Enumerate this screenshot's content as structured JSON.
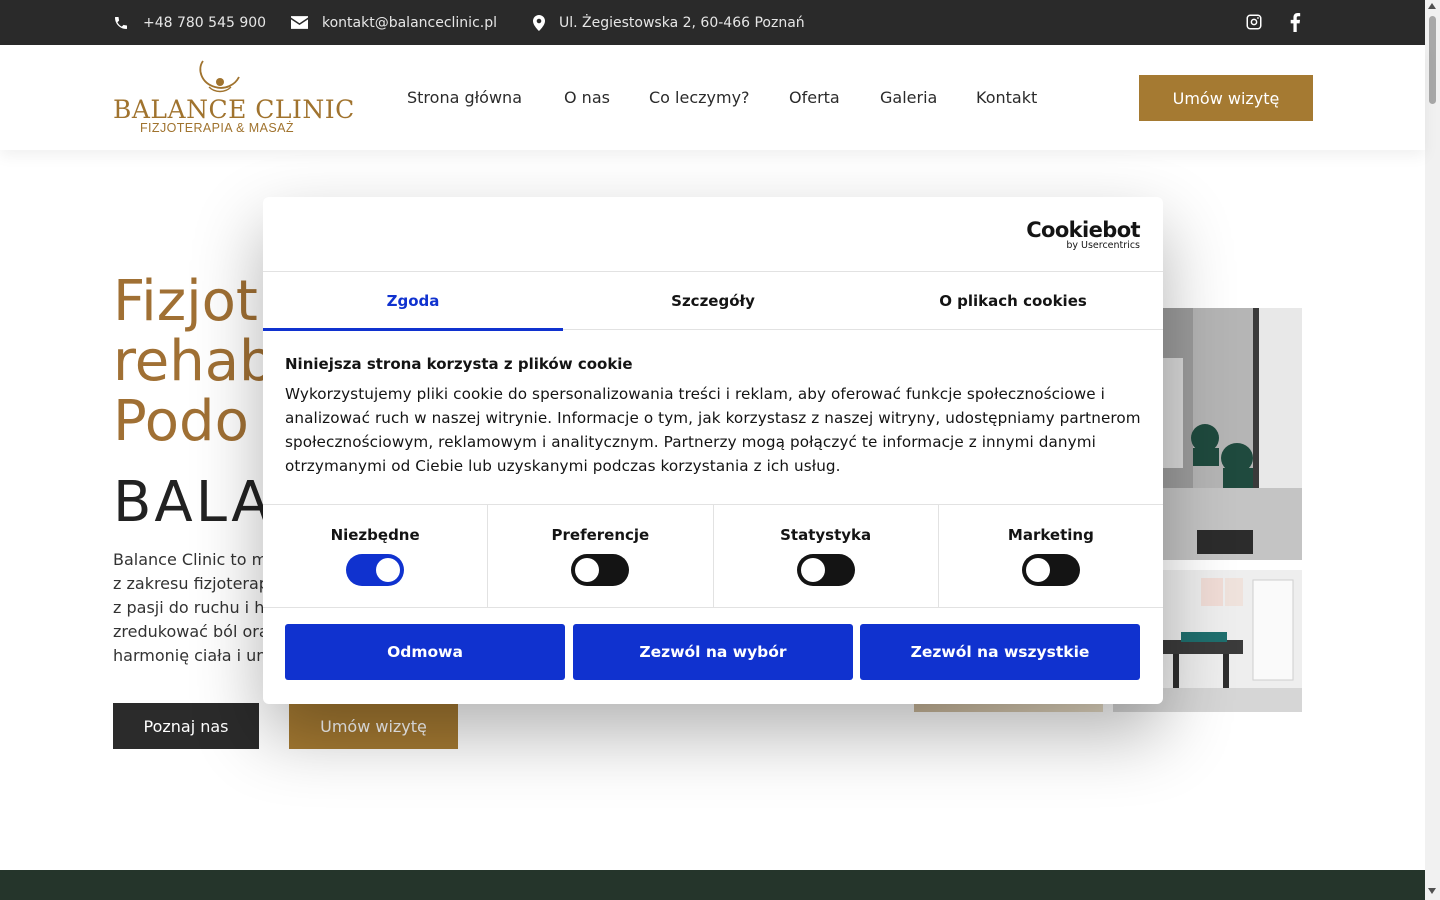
{
  "topbar": {
    "phone": "+48 780 545 900",
    "email": "kontakt@balanceclinic.pl",
    "address": "Ul. Żegiestowska 2, 60-466 Poznań",
    "icons": [
      "phone-icon",
      "envelope-icon",
      "map-pin-icon",
      "instagram-icon",
      "facebook-icon"
    ]
  },
  "header": {
    "logo_name": "BALANCE CLINIC",
    "logo_tagline": "FIZJOTERAPIA & MASAŻ",
    "nav": [
      "Strona główna",
      "O nas",
      "Co leczymy?",
      "Oferta",
      "Galeria",
      "Kontakt"
    ],
    "cta": "Umów wizytę"
  },
  "hero": {
    "title_lines": [
      "Fizjot",
      "rehab",
      "Podo"
    ],
    "brand": "BALA",
    "text_lines": [
      "Balance Clinic to m",
      "z zakresu fizjoterap",
      "z pasji do ruchu i h",
      "zredukować ból ora",
      "harmonię ciała i un"
    ],
    "btn_primary": "Poznaj nas",
    "btn_secondary": "Umów wizytę"
  },
  "cookie_dialog": {
    "brand": "Cookiebot",
    "brand_sub": "by Usercentrics",
    "tabs": [
      "Zgoda",
      "Szczegóły",
      "O plikach cookies"
    ],
    "active_tab": "Zgoda",
    "heading": "Niniejsza strona korzysta z plików cookie",
    "body": "Wykorzystujemy pliki cookie do spersonalizowania treści i reklam, aby oferować funkcje społecznościowe i analizować ruch w naszej witrynie. Informacje o tym, jak korzystasz z naszej witryny, udostępniamy partnerom społecznościowym, reklamowym i analitycznym. Partnerzy mogą połączyć te informacje z innymi danymi otrzymanymi od Ciebie lub uzyskanymi podczas korzystania z ich usług.",
    "categories": [
      {
        "label": "Niezbędne",
        "enabled": true
      },
      {
        "label": "Preferencje",
        "enabled": false
      },
      {
        "label": "Statystyka",
        "enabled": false
      },
      {
        "label": "Marketing",
        "enabled": false
      }
    ],
    "buttons": [
      "Odmowa",
      "Zezwól na wybór",
      "Zezwól na wszystkie"
    ]
  },
  "colors": {
    "gold": "#a57a32",
    "dark": "#2b2b2b",
    "cookie_blue": "#1032cf",
    "footer_green": "#25352b"
  }
}
